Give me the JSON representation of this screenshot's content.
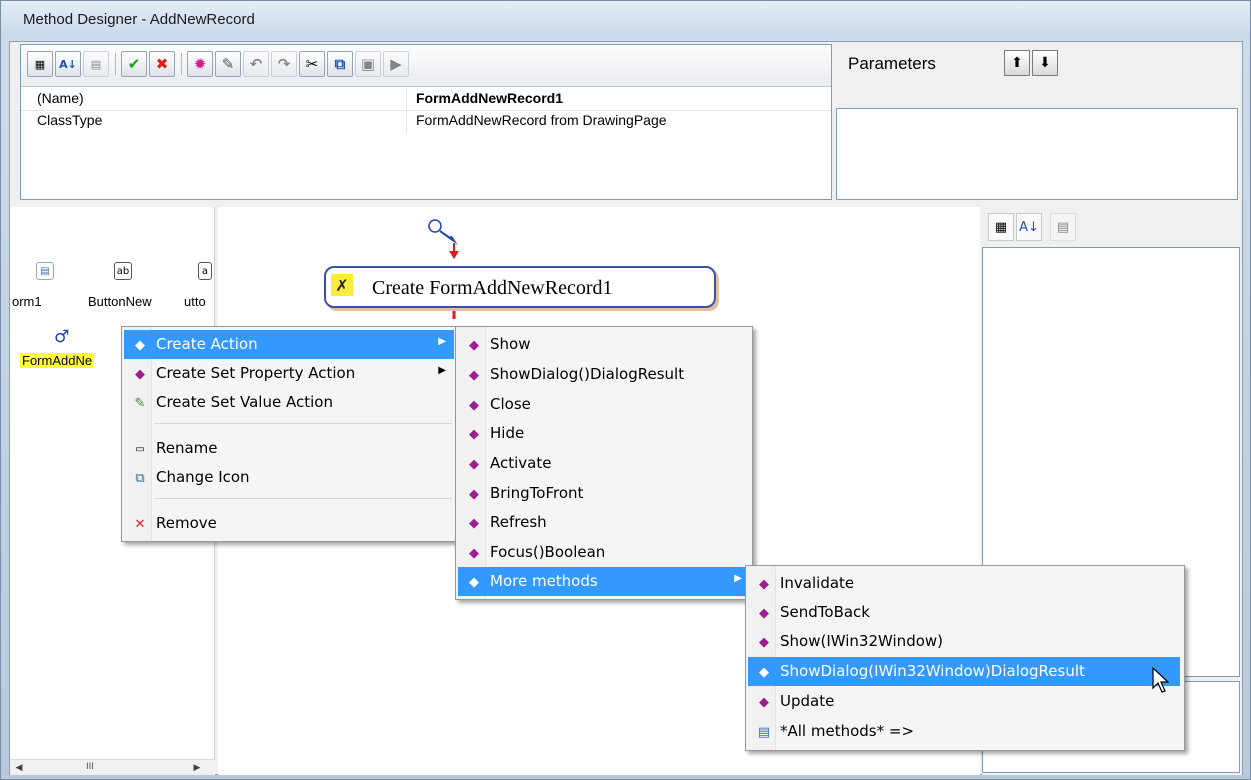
{
  "window": {
    "title": "Method Designer - AddNewRecord"
  },
  "properties": {
    "rows": [
      {
        "name": "(Name)",
        "value": "FormAddNewRecord1"
      },
      {
        "name": "ClassType",
        "value": "FormAddNewRecord from DrawingPage"
      }
    ]
  },
  "parameters": {
    "label": "Parameters"
  },
  "tray": {
    "items": [
      {
        "label": "orm1"
      },
      {
        "label": "ButtonNew"
      },
      {
        "label": "utto"
      },
      {
        "label": "FormAddNe"
      }
    ],
    "scroll_grip": "III"
  },
  "canvas": {
    "action_node": "Create FormAddNewRecord1"
  },
  "context_menu": {
    "items": [
      {
        "label": "Create Action"
      },
      {
        "label": "Create Set Property Action"
      },
      {
        "label": "Create Set Value Action"
      },
      {
        "label": "Rename"
      },
      {
        "label": "Change Icon"
      },
      {
        "label": "Remove"
      }
    ]
  },
  "submenu": {
    "items": [
      {
        "label": "Show"
      },
      {
        "label": "ShowDialog()DialogResult"
      },
      {
        "label": "Close"
      },
      {
        "label": "Hide"
      },
      {
        "label": "Activate"
      },
      {
        "label": "BringToFront"
      },
      {
        "label": "Refresh"
      },
      {
        "label": "Focus()Boolean"
      },
      {
        "label": "More methods"
      }
    ]
  },
  "more_menu": {
    "items": [
      {
        "label": "Invalidate"
      },
      {
        "label": "SendToBack"
      },
      {
        "label": "Show(IWin32Window)"
      },
      {
        "label": "ShowDialog(IWin32Window)DialogResult"
      },
      {
        "label": "Update"
      },
      {
        "label": "*All methods* =>"
      }
    ]
  },
  "colors": {
    "selection": "#3399ff",
    "menu_bg": "#f5f5f5",
    "node_border": "#3f4fa3"
  }
}
